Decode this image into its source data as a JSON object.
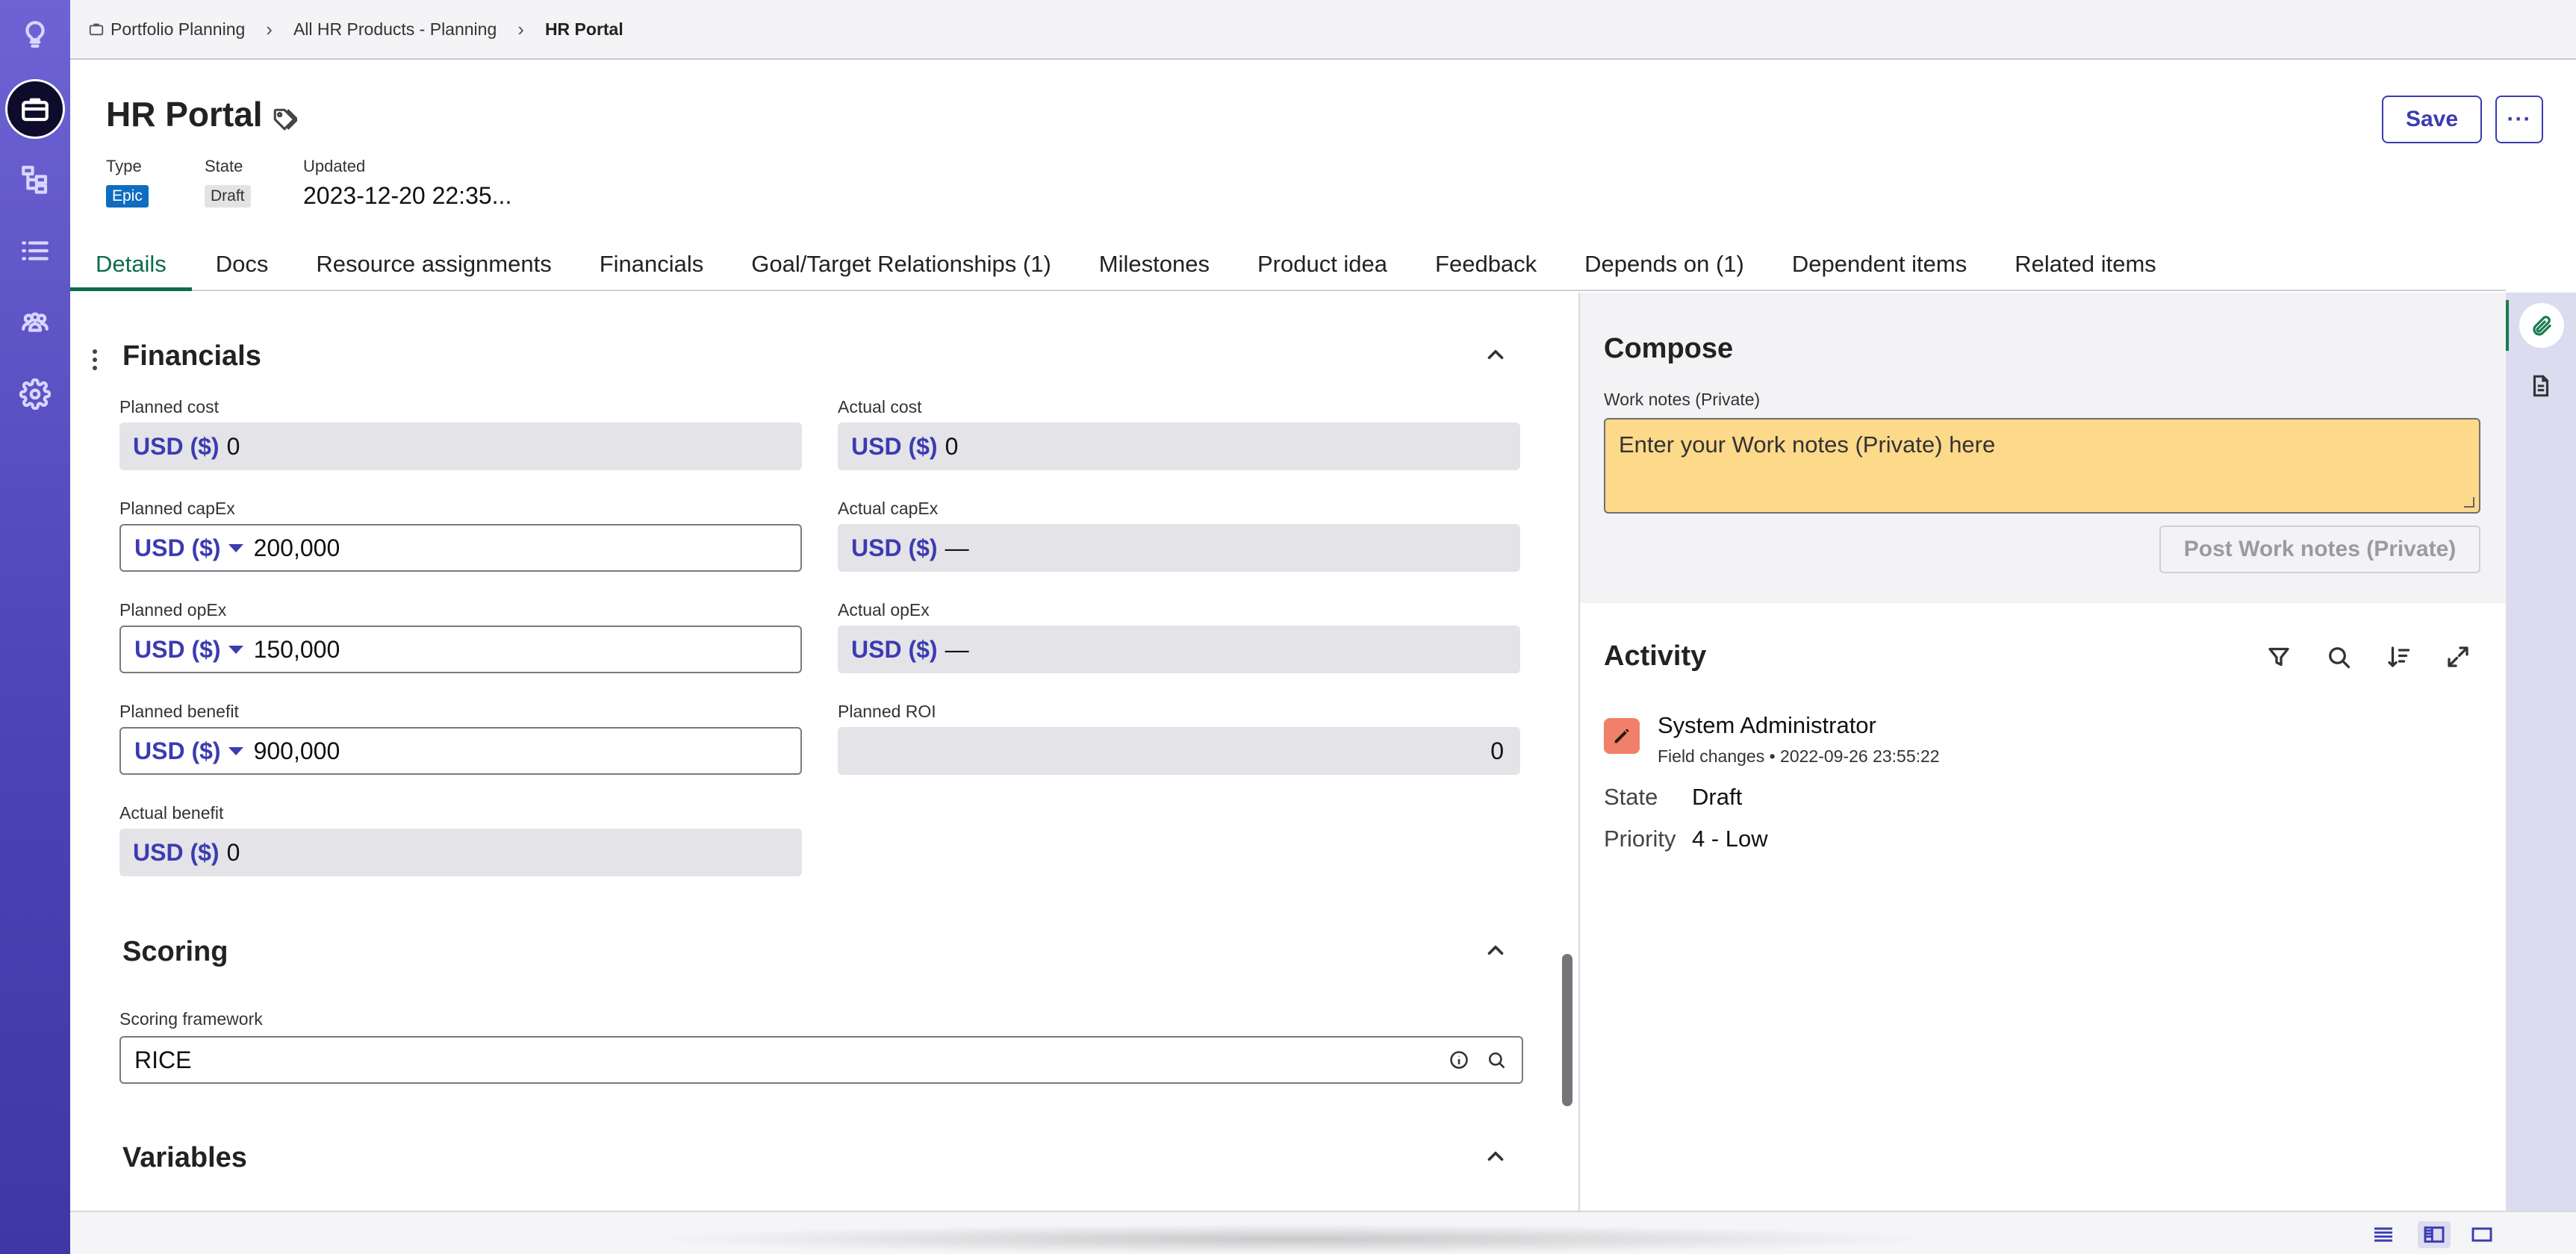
{
  "breadcrumb": {
    "items": [
      "Portfolio Planning",
      "All HR Products - Planning",
      "HR Portal"
    ]
  },
  "header": {
    "title": "HR Portal",
    "type_label": "Type",
    "type_value": "Epic",
    "state_label": "State",
    "state_value": "Draft",
    "updated_label": "Updated",
    "updated_value": "2023-12-20 22:35...",
    "save_label": "Save",
    "more_label": "···"
  },
  "tabs": [
    {
      "label": "Details",
      "active": true
    },
    {
      "label": "Docs"
    },
    {
      "label": "Resource assignments"
    },
    {
      "label": "Financials"
    },
    {
      "label": "Goal/Target Relationships (1)"
    },
    {
      "label": "Milestones"
    },
    {
      "label": "Product idea"
    },
    {
      "label": "Feedback"
    },
    {
      "label": "Depends on (1)"
    },
    {
      "label": "Dependent items"
    },
    {
      "label": "Related items"
    }
  ],
  "financials": {
    "heading": "Financials",
    "currency": "USD ($)",
    "planned_cost": {
      "label": "Planned cost",
      "value": "0"
    },
    "actual_cost": {
      "label": "Actual cost",
      "value": "0"
    },
    "planned_capex": {
      "label": "Planned capEx",
      "value": "200,000"
    },
    "actual_capex": {
      "label": "Actual capEx",
      "value": "—"
    },
    "planned_opex": {
      "label": "Planned opEx",
      "value": "150,000"
    },
    "actual_opex": {
      "label": "Actual opEx",
      "value": "—"
    },
    "planned_benefit": {
      "label": "Planned benefit",
      "value": "900,000"
    },
    "planned_roi": {
      "label": "Planned ROI",
      "value": "0"
    },
    "actual_benefit": {
      "label": "Actual benefit",
      "value": "0"
    }
  },
  "scoring": {
    "heading": "Scoring",
    "framework_label": "Scoring framework",
    "framework_value": "RICE"
  },
  "variables": {
    "heading": "Variables"
  },
  "compose": {
    "heading": "Compose",
    "work_notes_label": "Work notes (Private)",
    "work_notes_placeholder": "Enter your Work notes (Private) here",
    "post_label": "Post Work notes (Private)"
  },
  "activity": {
    "heading": "Activity",
    "entry": {
      "user": "System Administrator",
      "subtitle": "Field changes • 2022-09-26 23:55:22",
      "changes": [
        {
          "field": "State",
          "value": "Draft"
        },
        {
          "field": "Priority",
          "value": "4 - Low"
        }
      ]
    }
  },
  "colors": {
    "accent": "#3b3bb3",
    "tab_active": "#0b6b4f",
    "epic_badge": "#0f6dbf",
    "work_notes_bg": "#fdd98a",
    "avatar_bg": "#f0806a",
    "rail": "#5a52c8"
  }
}
